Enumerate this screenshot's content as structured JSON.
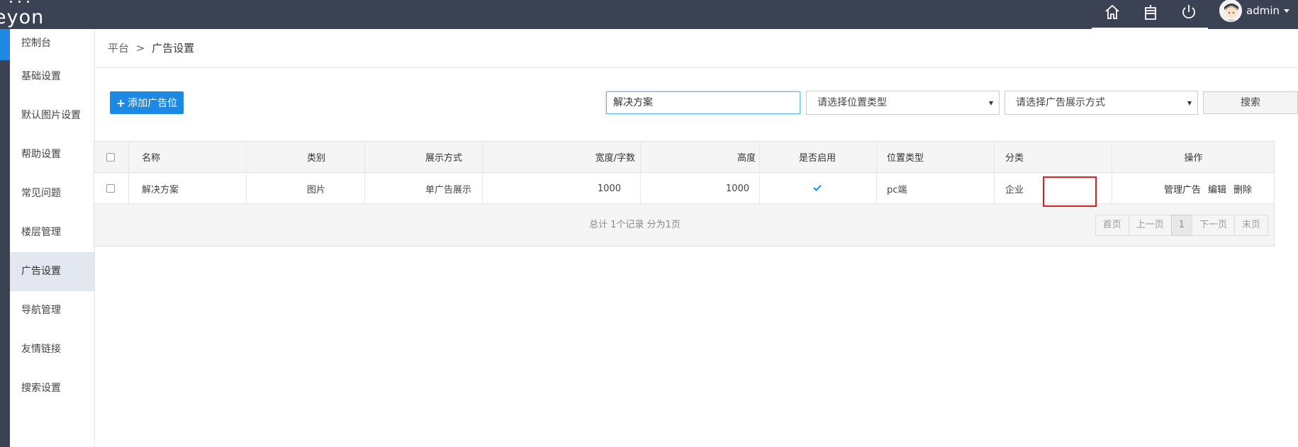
{
  "app": {
    "logo_text": "eyon"
  },
  "header": {
    "user_name": "admin"
  },
  "sidebar": {
    "items": [
      {
        "label": "控制台"
      },
      {
        "label": "基础设置"
      },
      {
        "label": "默认图片设置"
      },
      {
        "label": "帮助设置"
      },
      {
        "label": "常见问题"
      },
      {
        "label": "楼层管理"
      },
      {
        "label": "广告设置"
      },
      {
        "label": "导航管理"
      },
      {
        "label": "友情链接"
      },
      {
        "label": "搜索设置"
      }
    ],
    "active_index": 6
  },
  "breadcrumb": {
    "root": "平台",
    "sep": ">",
    "current": "广告设置"
  },
  "toolbar": {
    "add_label": "添加广告位",
    "search_value": "解决方案",
    "position_type_placeholder": "请选择位置类型",
    "display_mode_placeholder": "请选择广告展示方式",
    "search_label": "搜索"
  },
  "table": {
    "columns": [
      "名称",
      "类别",
      "展示方式",
      "宽度/字数",
      "高度",
      "是否启用",
      "位置类型",
      "分类",
      "操作"
    ],
    "rows": [
      {
        "name": "解决方案",
        "category": "图片",
        "display": "单广告展示",
        "width": "1000",
        "height": "1000",
        "enabled": true,
        "position_type": "pc端",
        "classification": "企业",
        "actions": {
          "manage": "管理广告",
          "edit": "编辑",
          "delete": "删除"
        }
      }
    ]
  },
  "pagination": {
    "summary": "总计 1个记录 分为1页",
    "first": "首页",
    "prev": "上一页",
    "current": "1",
    "next": "下一页",
    "last": "末页"
  },
  "colors": {
    "topbar": "#3b4254",
    "accent": "#1e88e5",
    "highlight": "#e02020"
  }
}
